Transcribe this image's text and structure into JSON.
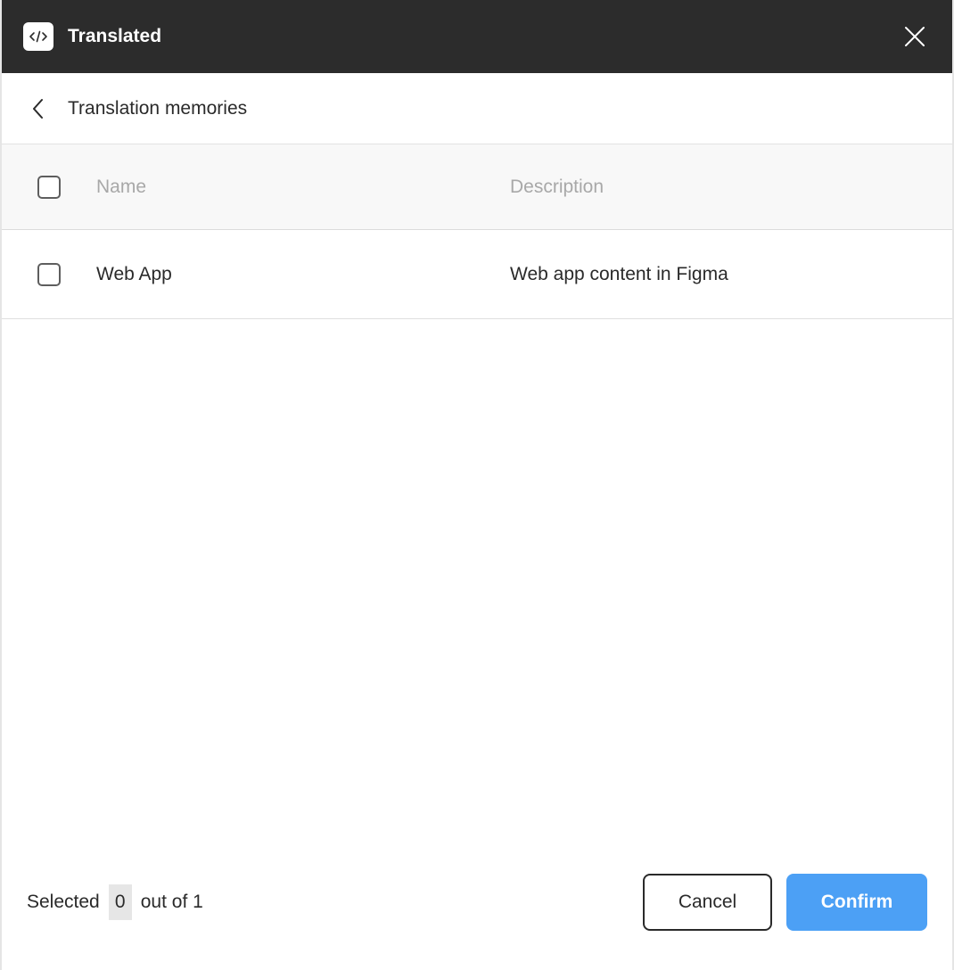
{
  "window": {
    "app_title": "Translated",
    "logo_icon": "code-brackets-icon",
    "close_icon": "close-icon"
  },
  "subheader": {
    "title": "Translation memories",
    "back_icon": "chevron-left-icon"
  },
  "table": {
    "columns": [
      "Name",
      "Description"
    ],
    "rows": [
      {
        "name": "Web App",
        "description": "Web app content in Figma",
        "checked": false
      }
    ],
    "select_all_checked": false
  },
  "footer": {
    "selected_prefix": "Selected",
    "selected_count": "0",
    "selected_suffix": "out of 1",
    "cancel_label": "Cancel",
    "confirm_label": "Confirm"
  },
  "colors": {
    "titlebar": "#2c2c2c",
    "accent": "#4ca0f5",
    "header_bg": "#f8f8f8"
  }
}
